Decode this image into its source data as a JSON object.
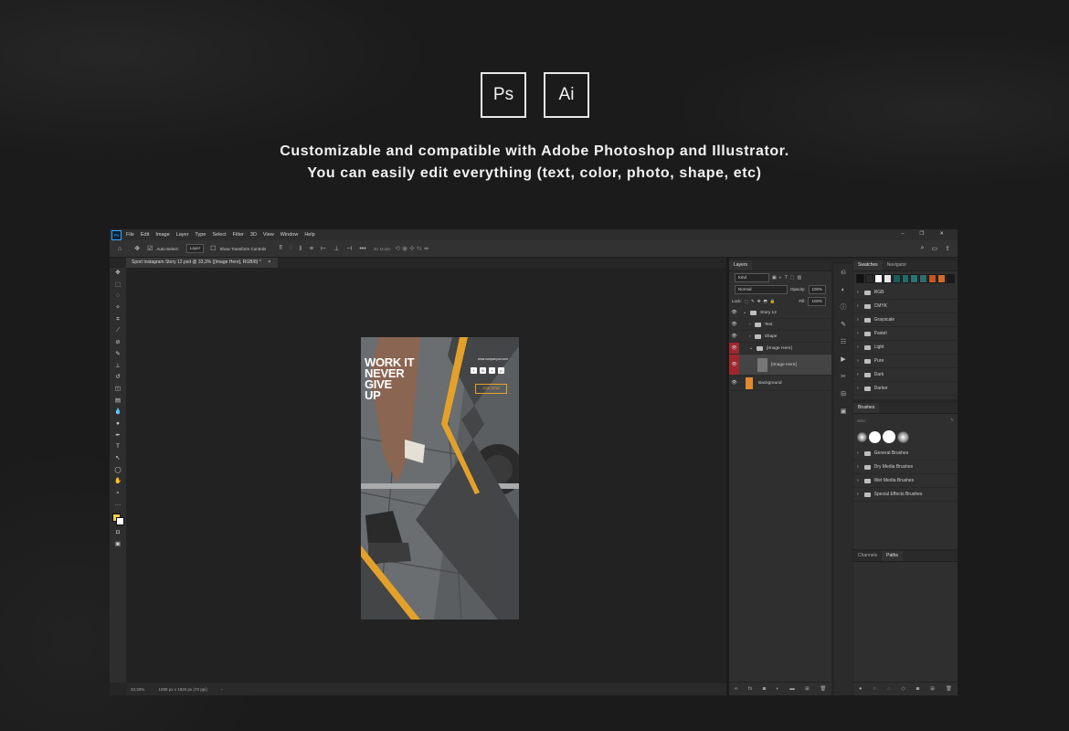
{
  "logos": {
    "ps": "Ps",
    "ai": "Ai"
  },
  "tagline": {
    "line1": "Customizable and compatible with Adobe Photoshop and Illustrator.",
    "line2": "You can easily edit everything (text, color, photo, shape, etc)"
  },
  "menu": {
    "ps_badge": "Ps",
    "items": [
      "File",
      "Edit",
      "Image",
      "Layer",
      "Type",
      "Select",
      "Filter",
      "3D",
      "View",
      "Window",
      "Help"
    ]
  },
  "options_bar": {
    "auto_select": "Auto-Select:",
    "layer_value": "Layer",
    "show_transform": "Show Transform Controls",
    "mode_3d": "3D Mode:"
  },
  "document": {
    "tab_title": "Sport Instagram Story 12.psd @ 33,3% ([Image Here], RGB/8) *",
    "zoom": "33,33%",
    "doc_size": "1080 px x 1920 px (72 ppi)"
  },
  "artboard": {
    "headline": [
      "WORK IT",
      "NEVER",
      "GIVE",
      "UP"
    ],
    "website": "www.companyurl.com",
    "button": "JOIN NOW!",
    "colors": {
      "accent": "#e4a12a",
      "dark": "#4e4f50"
    }
  },
  "layers_panel": {
    "title": "Layers",
    "kind": "Kind",
    "blend": "Normal",
    "opacity_label": "Opacity:",
    "opacity": "100%",
    "lock_label": "Lock:",
    "fill_label": "Fill:",
    "fill": "100%",
    "rows": [
      {
        "name": "Story 12"
      },
      {
        "name": "Text"
      },
      {
        "name": "Shape"
      },
      {
        "name": "[Image Here]"
      },
      {
        "name": "[Image Here]"
      },
      {
        "name": "Background"
      }
    ]
  },
  "swatches_panel": {
    "tabs": [
      "Swatches",
      "Navigator"
    ],
    "colors": [
      "#111111",
      "#2a2a2a",
      "#ffffff",
      "#e6e6e6",
      "#1b5c5c",
      "#236b6b",
      "#2b7373",
      "#2f6d6f",
      "#c8551f",
      "#d46a28",
      "#1b1b1b"
    ],
    "groups": [
      "RGB",
      "CMYK",
      "Grayscale",
      "Pastel",
      "Light",
      "Pure",
      "Dark",
      "Darker"
    ]
  },
  "brushes_panel": {
    "title": "Brushes",
    "size_label": "Size:",
    "groups": [
      "General Brushes",
      "Dry Media Brushes",
      "Wet Media Brushes",
      "Special Effects Brushes"
    ]
  },
  "channels_panel": {
    "tabs": [
      "Channels",
      "Paths"
    ]
  }
}
